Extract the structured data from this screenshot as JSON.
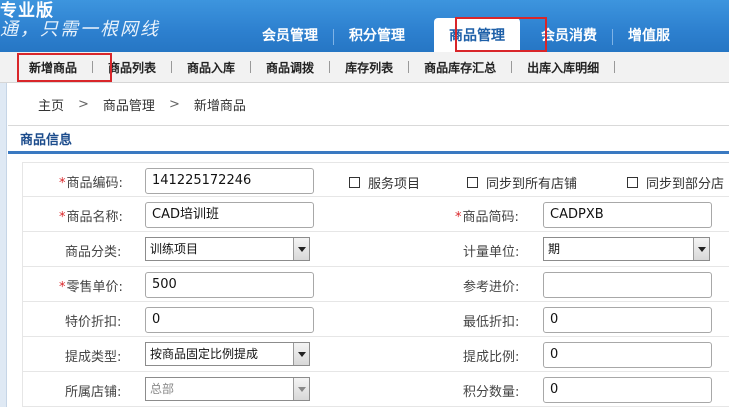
{
  "brand": {
    "title": "专业版",
    "slogan": "通，只需一根网线"
  },
  "main_nav": {
    "tabs": [
      {
        "label": "会员管理",
        "active": false
      },
      {
        "label": "积分管理",
        "active": false
      },
      {
        "label": "商品管理",
        "active": true
      },
      {
        "label": "会员消费",
        "active": false
      },
      {
        "label": "增值服",
        "active": false
      }
    ]
  },
  "sub_nav": {
    "items": [
      "新增商品",
      "商品列表",
      "商品入库",
      "商品调拨",
      "库存列表",
      "商品库存汇总",
      "出库入库明细"
    ]
  },
  "breadcrumb": {
    "home": "主页",
    "section": "商品管理",
    "page": "新增商品",
    "separator": ">"
  },
  "section_title": "商品信息",
  "form": {
    "required_mark": "*",
    "product_code": {
      "label": "商品编码:",
      "value": "141225172246"
    },
    "service_item": {
      "label": "服务项目",
      "checked": false
    },
    "sync_all": {
      "label": "同步到所有店铺",
      "checked": false
    },
    "sync_some": {
      "label": "同步到部分店",
      "checked": false
    },
    "product_name": {
      "label": "商品名称:",
      "value": "CAD培训班"
    },
    "product_abbr": {
      "label": "商品简码:",
      "value": "CADPXB"
    },
    "category": {
      "label": "商品分类:",
      "value": "训练项目"
    },
    "unit": {
      "label": "计量单位:",
      "value": "期"
    },
    "retail_price": {
      "label": "零售单价:",
      "value": "500"
    },
    "ref_purchase_price": {
      "label": "参考进价:",
      "value": ""
    },
    "special_discount": {
      "label": "特价折扣:",
      "value": "0"
    },
    "min_discount": {
      "label": "最低折扣:",
      "value": "0"
    },
    "commission_type": {
      "label": "提成类型:",
      "value": "按商品固定比例提成"
    },
    "commission_ratio": {
      "label": "提成比例:",
      "value": "0"
    },
    "store": {
      "label": "所属店铺:",
      "value": "总部"
    },
    "points": {
      "label": "积分数量:",
      "value": "0"
    }
  },
  "colors": {
    "header_blue": "#2d80cf",
    "highlight_red": "#d9262a",
    "section_blue": "#3a79c1"
  }
}
